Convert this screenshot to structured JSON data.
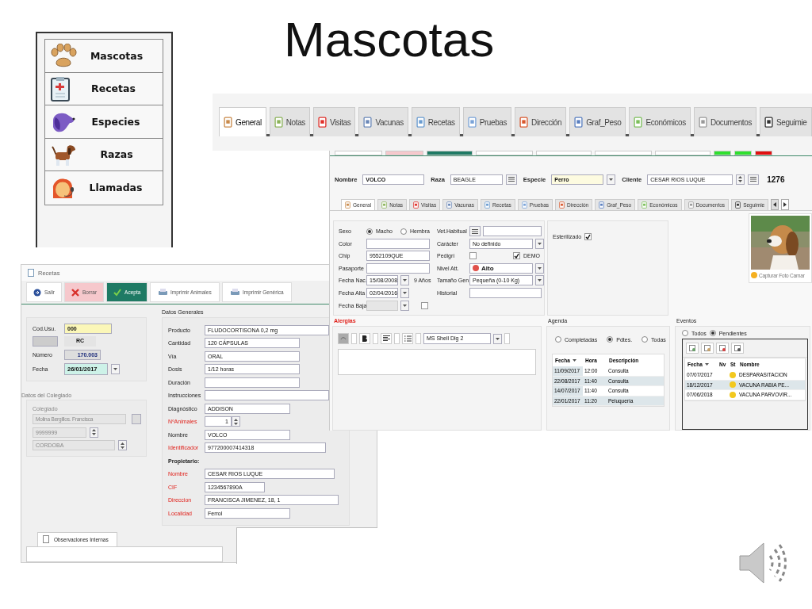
{
  "slide_title": "Mascotas",
  "menu": [
    {
      "label": "Mascotas"
    },
    {
      "label": "Recetas"
    },
    {
      "label": "Especies"
    },
    {
      "label": "Razas"
    },
    {
      "label": "Llamadas"
    }
  ],
  "main_tabs": [
    {
      "label": "General",
      "selected": true
    },
    {
      "label": "Notas",
      "selected": false
    },
    {
      "label": "Visitas",
      "selected": false
    },
    {
      "label": "Vacunas",
      "selected": false
    },
    {
      "label": "Recetas",
      "selected": false
    },
    {
      "label": "Pruebas",
      "selected": false
    },
    {
      "label": "Dirección",
      "selected": false
    },
    {
      "label": "Graf_Peso",
      "selected": false
    },
    {
      "label": "Económicos",
      "selected": false
    },
    {
      "label": "Documentos",
      "selected": false
    },
    {
      "label": "Seguimie",
      "selected": false
    }
  ],
  "animal_window": {
    "header": [
      {
        "kind": "text",
        "label": "Nombre",
        "value": "VOLCO"
      },
      {
        "kind": "list",
        "label": "Raza",
        "value": "BEAGLE"
      },
      {
        "kind": "select",
        "label": "Especie",
        "value": "Perro"
      },
      {
        "kind": "spin",
        "label": "Cliente",
        "value": "CESAR RIOS LUQUE"
      }
    ],
    "client_number": "1276",
    "tabs": [
      {
        "label": "General",
        "selected": true
      },
      {
        "label": "Notas",
        "selected": false
      },
      {
        "label": "Visitas",
        "selected": false
      },
      {
        "label": "Vacunas",
        "selected": false
      },
      {
        "label": "Recetas",
        "selected": false
      },
      {
        "label": "Pruebas",
        "selected": false
      },
      {
        "label": "Dirección",
        "selected": false
      },
      {
        "label": "Graf_Peso",
        "selected": false
      },
      {
        "label": "Económicos",
        "selected": false
      },
      {
        "label": "Documentos",
        "selected": false
      },
      {
        "label": "Seguimie",
        "selected": false
      }
    ],
    "left_fields": [
      {
        "kind": "radio",
        "label": "Sexo",
        "options": [
          {
            "label": "Macho",
            "selected": true
          },
          {
            "label": "Hembra",
            "selected": false
          }
        ]
      },
      {
        "kind": "text",
        "label": "Color"
      },
      {
        "kind": "text",
        "label": "Chip",
        "value": "9552109QUE"
      },
      {
        "kind": "text",
        "label": "Pasaporte"
      },
      {
        "kind": "date",
        "label": "Fecha Nac.",
        "value": "15/08/2008",
        "note": "9 Años",
        "disabled": false
      },
      {
        "kind": "date",
        "label": "Fecha Alta",
        "value": "02/04/2016",
        "disabled": false
      },
      {
        "kind": "date",
        "label": "Fecha Baja",
        "disabled": true,
        "checked": false
      }
    ],
    "right_fields": [
      {
        "kind": "list",
        "label": "Vet.Habitual"
      },
      {
        "kind": "select",
        "label": "Carácter",
        "value": "No definido"
      },
      {
        "kind": "checks",
        "label": "Pedigrí",
        "checked": false,
        "extra": {
          "label": "DEMO",
          "checked": true
        }
      },
      {
        "kind": "level",
        "label": "Nivel Att.",
        "value": "Alto",
        "color": "#e0504a"
      },
      {
        "kind": "select",
        "label": "Tamaño Gen",
        "value": "Pequeña (0-10 Kg)"
      },
      {
        "kind": "text",
        "label": "Historial"
      }
    ],
    "sterilized": {
      "label": "Esterilizado",
      "checked": true
    },
    "photo_caption": "Capturar Foto Camar",
    "allergies": {
      "title": "Alergias",
      "font": "MS Shell Dlg 2"
    },
    "agenda": {
      "title": "Agenda",
      "filters": [
        {
          "label": "Completadas",
          "selected": false
        },
        {
          "label": "Pdtes.",
          "selected": true
        },
        {
          "label": "Todas",
          "selected": false
        }
      ],
      "columns": [
        "Fecha",
        "Hora",
        "Descripción"
      ],
      "rows": [
        [
          "11/09/2017",
          "12:00",
          "Consulta"
        ],
        [
          "22/08/2017",
          "11:40",
          "Consulta"
        ],
        [
          "14/07/2017",
          "11:40",
          "Consulta"
        ],
        [
          "22/01/2017",
          "11:20",
          "Peluquería"
        ]
      ]
    },
    "events": {
      "title": "Eventos",
      "filters": [
        {
          "label": "Todos",
          "selected": false
        },
        {
          "label": "Pendientes",
          "selected": true
        }
      ],
      "columns": [
        "Fecha",
        "Nv",
        "St",
        "Nombre"
      ],
      "rows": [
        {
          "date": "07/07/2017",
          "color": "#f2c81e",
          "name": "DESPARASITACION"
        },
        {
          "date": "18/12/2017",
          "color": "#f2c81e",
          "name": "VACUNA RABIA PE..."
        },
        {
          "date": "07/06/2018",
          "color": "#f2c81e",
          "name": "VACUNA PARVOVIR..."
        }
      ]
    }
  },
  "recipe_window": {
    "title": "Recetas",
    "toolbar": [
      {
        "label": "Salir",
        "kind": "exit"
      },
      {
        "label": "Borrar",
        "kind": "delete"
      },
      {
        "label": "Acepta",
        "kind": "accept"
      },
      {
        "label": "Imprimir Animales",
        "kind": "print"
      },
      {
        "label": "Imprimir Genérica",
        "kind": "print"
      }
    ],
    "user_code": {
      "label": "Cod.Usu.",
      "value": "000"
    },
    "series": "RC",
    "number": {
      "label": "Número",
      "value": "170.003"
    },
    "date": {
      "label": "Fecha",
      "value": "26/01/2017"
    },
    "collegiate": {
      "title": "Datos del Colegiado",
      "label": "Colegiado",
      "name": "Molina Bergillos. Francisca",
      "number": "9999999",
      "province": "CORDOBA"
    },
    "general": {
      "title": "Datos Generales",
      "rows": [
        {
          "kind": "text",
          "label": "Producto",
          "value": "FLUDOCORTISONA 0,2 mg",
          "required": false
        },
        {
          "kind": "text",
          "label": "Cantidad",
          "value": "120 CÁPSULAS",
          "required": false
        },
        {
          "kind": "text",
          "label": "Vía",
          "value": "ORAL",
          "required": false
        },
        {
          "kind": "text",
          "label": "Dosis",
          "value": "1/12 horas",
          "required": false
        },
        {
          "kind": "text",
          "label": "Duración",
          "required": false
        },
        {
          "kind": "text",
          "label": "Instrucciones",
          "required": false
        },
        {
          "kind": "text",
          "label": "Diagnóstico",
          "value": "ADDISON",
          "required": false
        },
        {
          "kind": "spin",
          "label": "NºAnimales",
          "value": "1",
          "required": true
        },
        {
          "kind": "text",
          "label": "Nombre",
          "value": "VOLCO",
          "required": false
        },
        {
          "kind": "text",
          "label": "Identificador",
          "value": "977200007414318",
          "required": true
        },
        {
          "kind": "heading",
          "label": "Propietario:"
        },
        {
          "kind": "text",
          "label": "Nombre",
          "value": "CESAR RIOS LUQUE",
          "required": true
        },
        {
          "kind": "text",
          "label": "CIF",
          "value": "1234567890A",
          "required": true
        },
        {
          "kind": "text",
          "label": "Direccion",
          "value": "FRANCISCA JIMENEZ, 18, 1",
          "required": true
        },
        {
          "kind": "text",
          "label": "Localidad",
          "value": "Ferrol",
          "required": true
        }
      ]
    },
    "notes_tab": "Observaciones Internas"
  }
}
